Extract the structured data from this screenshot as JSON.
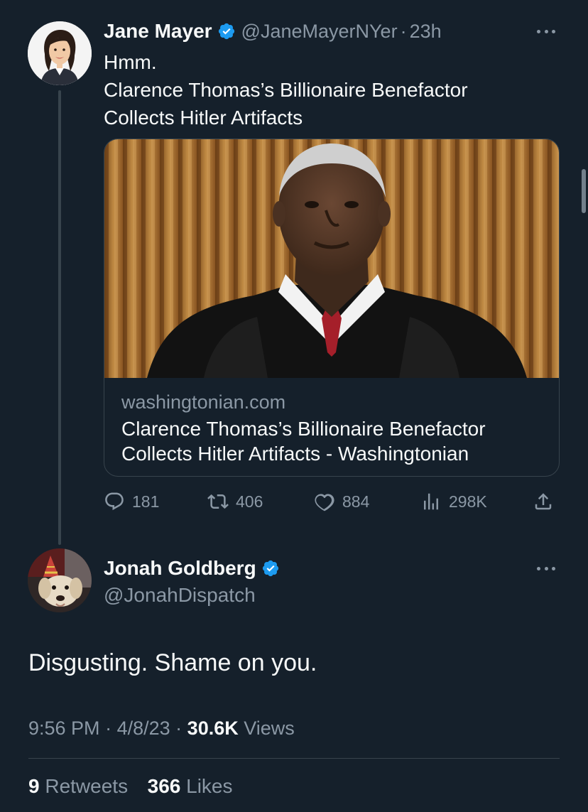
{
  "tweet1": {
    "name": "Jane Mayer",
    "handle": "@JaneMayerNYer",
    "time": "23h",
    "text_line1": "Hmm.",
    "text_line2": "Clarence Thomas’s Billionaire Benefactor",
    "text_line3": "Collects Hitler Artifacts",
    "card": {
      "domain": "washingtonian.com",
      "title_line1": "Clarence Thomas’s Billionaire Benefactor",
      "title_line2": "Collects Hitler Artifacts - Washingtonian"
    },
    "actions": {
      "replies": "181",
      "retweets": "406",
      "likes": "884",
      "views": "298K"
    }
  },
  "tweet2": {
    "name": "Jonah Goldberg",
    "handle": "@JonahDispatch",
    "text": "Disgusting. Shame on you.",
    "meta": {
      "time": "9:56 PM",
      "date": "4/8/23",
      "views_count": "30.6K",
      "views_label": "Views"
    },
    "stats": {
      "retweets_count": "9",
      "retweets_label": "Retweets",
      "likes_count": "366",
      "likes_label": "Likes"
    }
  },
  "colors": {
    "background": "#15202b",
    "text_primary": "#f7f9f9",
    "text_secondary": "#8b98a5",
    "verified_blue": "#1d9bf0",
    "border": "#38444d"
  }
}
